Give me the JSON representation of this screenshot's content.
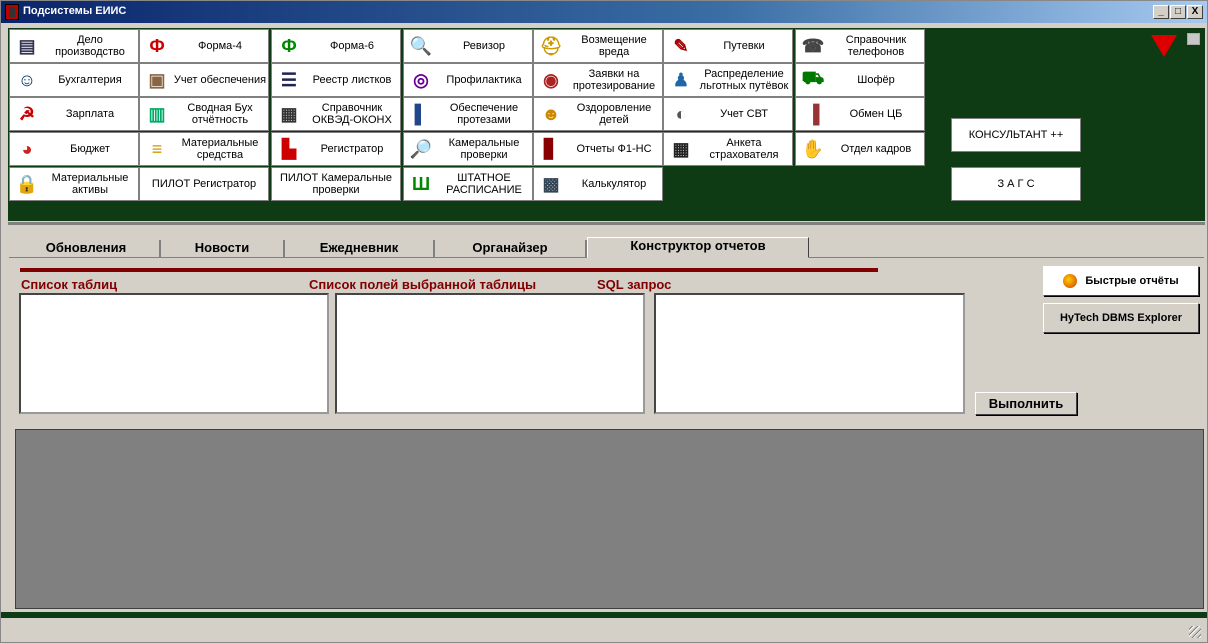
{
  "window": {
    "title": "Подсистемы ЕИИС",
    "min_label": "_",
    "max_label": "□",
    "close_label": "X"
  },
  "grid": [
    {
      "label": "Дело производство",
      "icon": "folder-icon"
    },
    {
      "label": "Форма-4",
      "icon": "form4-icon"
    },
    {
      "label": "Форма-6",
      "icon": "form6-icon"
    },
    {
      "label": "Ревизор",
      "icon": "magnifier-icon"
    },
    {
      "label": "Возмещение вреда",
      "icon": "helmet-icon"
    },
    {
      "label": "Путевки",
      "icon": "pin-icon"
    },
    {
      "label": "Справочник телефонов",
      "icon": "phone-icon"
    },
    {
      "label": "Бухгалтерия",
      "icon": "people-icon"
    },
    {
      "label": "Учет обеспечения",
      "icon": "box-icon"
    },
    {
      "label": "Реестр листков",
      "icon": "sheet-icon"
    },
    {
      "label": "Профилактика",
      "icon": "target-icon"
    },
    {
      "label": "Заявки на протезирование",
      "icon": "disk-icon"
    },
    {
      "label": "Распределение льготных путёвок",
      "icon": "person-icon"
    },
    {
      "label": "Шофёр",
      "icon": "car-icon"
    },
    {
      "label": "Зарплата",
      "icon": "sickle-icon"
    },
    {
      "label": "Сводная Бух отчётность",
      "icon": "notebook-icon"
    },
    {
      "label": "Справочник ОКВЭД-ОКОНХ",
      "icon": "registry-icon"
    },
    {
      "label": "Обеспечение протезами",
      "icon": "book-icon"
    },
    {
      "label": "Оздоровление детей",
      "icon": "smiley-icon"
    },
    {
      "label": "Учет СВТ",
      "icon": "mouse-icon"
    },
    {
      "label": "Обмен ЦБ",
      "icon": "books-icon"
    },
    {
      "label": "Бюджет",
      "icon": "pie-icon"
    },
    {
      "label": "Материальные средства",
      "icon": "stack-icon"
    },
    {
      "label": "Регистратор",
      "icon": "registrar-icon"
    },
    {
      "label": "Камеральные проверки",
      "icon": "magnifier2-icon"
    },
    {
      "label": "Отчеты Ф1-НС",
      "icon": "report-book-icon"
    },
    {
      "label": "Анкета страхователя",
      "icon": "form-icon"
    },
    {
      "label": "Отдел кадров",
      "icon": "handshake-icon"
    },
    {
      "label": "Материальные активы",
      "icon": "lock-icon"
    },
    {
      "label": "ПИЛОТ Регистратор",
      "icon": ""
    },
    {
      "label": "ПИЛОТ Камеральные проверки",
      "icon": ""
    },
    {
      "label": "ШТАТНОЕ РАСПИСАНИЕ",
      "icon": "sr-icon"
    },
    {
      "label": "Калькулятор",
      "icon": "calculator-icon"
    }
  ],
  "side": {
    "consultant": "КОНСУЛЬТАНТ ++",
    "zags": "З А Г С"
  },
  "tabs": [
    "Обновления",
    "Новости",
    "Ежедневник",
    "Органайзер",
    "Конструктор отчетов"
  ],
  "active_tab": "Конструктор отчетов",
  "constructor": {
    "tables_label": "Список таблиц",
    "fields_label": "Список полей выбранной таблицы",
    "sql_label": "SQL запрос",
    "quick_reports": "Быстрые отчёты",
    "explorer": "HyTech DBMS Explorer",
    "execute": "Выполнить"
  },
  "colors": {
    "panel_green": "#0e3a14",
    "header_red": "#800000",
    "output_grey": "#808080"
  }
}
